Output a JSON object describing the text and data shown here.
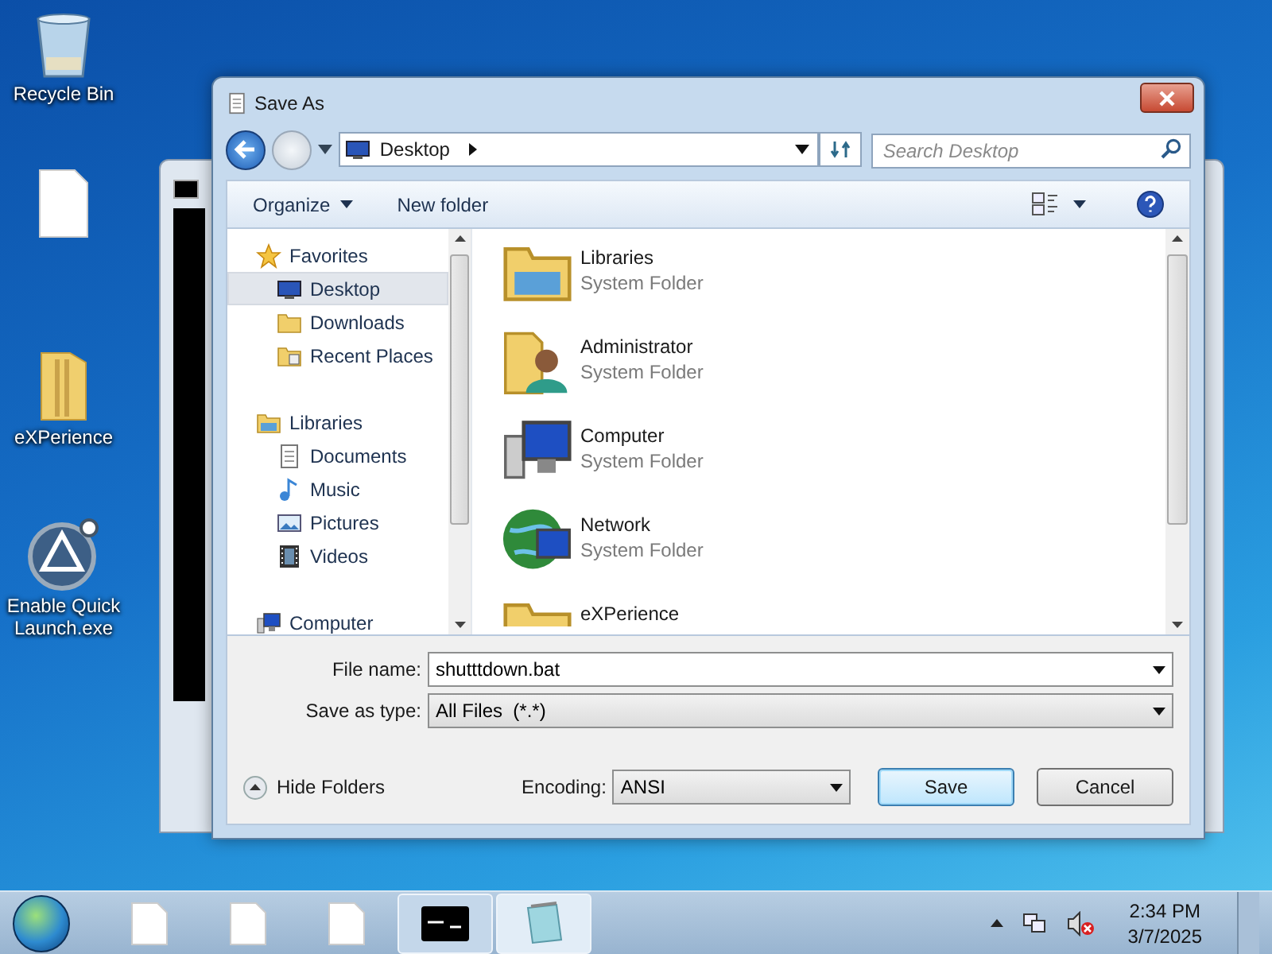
{
  "desktop_icons": [
    {
      "kind": "recycle",
      "label": "Recycle Bin"
    },
    {
      "kind": "file"
    },
    {
      "kind": "folder",
      "label": "eXPerience"
    },
    {
      "kind": "app",
      "label": "Enable Quick Launch.exe"
    }
  ],
  "dialog": {
    "title": "Save As",
    "address": {
      "location": "Desktop"
    },
    "search": {
      "placeholder": "Search Desktop"
    },
    "toolbar": [
      {
        "label": "Organize",
        "menu": true
      },
      {
        "label": "New folder",
        "menu": false
      }
    ],
    "nav_pane": [
      {
        "label": "Favorites",
        "kind": "star",
        "selected": false,
        "children": [
          {
            "label": "Desktop",
            "kind": "desktop",
            "selected": true
          },
          {
            "label": "Downloads",
            "kind": "folder",
            "selected": false
          },
          {
            "label": "Recent Places",
            "kind": "recent",
            "selected": false
          }
        ]
      },
      {
        "label": "Libraries",
        "kind": "library",
        "selected": false,
        "children": [
          {
            "label": "Documents",
            "kind": "document",
            "selected": false
          },
          {
            "label": "Music",
            "kind": "music",
            "selected": false
          },
          {
            "label": "Pictures",
            "kind": "picture",
            "selected": false
          },
          {
            "label": "Videos",
            "kind": "video",
            "selected": false
          }
        ]
      },
      {
        "label": "Computer",
        "kind": "computer",
        "selected": false
      }
    ],
    "files": [
      {
        "name": "Libraries",
        "type": "System Folder",
        "kind": "library"
      },
      {
        "name": "Administrator",
        "type": "System Folder",
        "kind": "user"
      },
      {
        "name": "Computer",
        "type": "System Folder",
        "kind": "computer"
      },
      {
        "name": "Network",
        "type": "System Folder",
        "kind": "network"
      },
      {
        "name": "eXPerience",
        "kind": "folder"
      }
    ],
    "file_name": {
      "label": "File name:",
      "value": "shutttdown.bat"
    },
    "save_as_type": {
      "label": "Save as type:",
      "value": "All Files  (*.*)"
    },
    "hide_folders": "Hide Folders",
    "encoding": {
      "label": "Encoding:",
      "value": "ANSI"
    },
    "buttons": [
      {
        "label": "Save",
        "default": true
      },
      {
        "label": "Cancel",
        "default": false
      }
    ]
  },
  "taskbar": {
    "buttons": [
      {
        "kind": "file",
        "running": false,
        "active": false
      },
      {
        "kind": "file",
        "running": false,
        "active": false
      },
      {
        "kind": "file",
        "running": false,
        "active": false
      },
      {
        "kind": "console",
        "running": true,
        "active": false
      },
      {
        "kind": "notepad",
        "running": true,
        "active": true
      }
    ],
    "time": "2:34 PM",
    "date": "3/7/2025"
  }
}
